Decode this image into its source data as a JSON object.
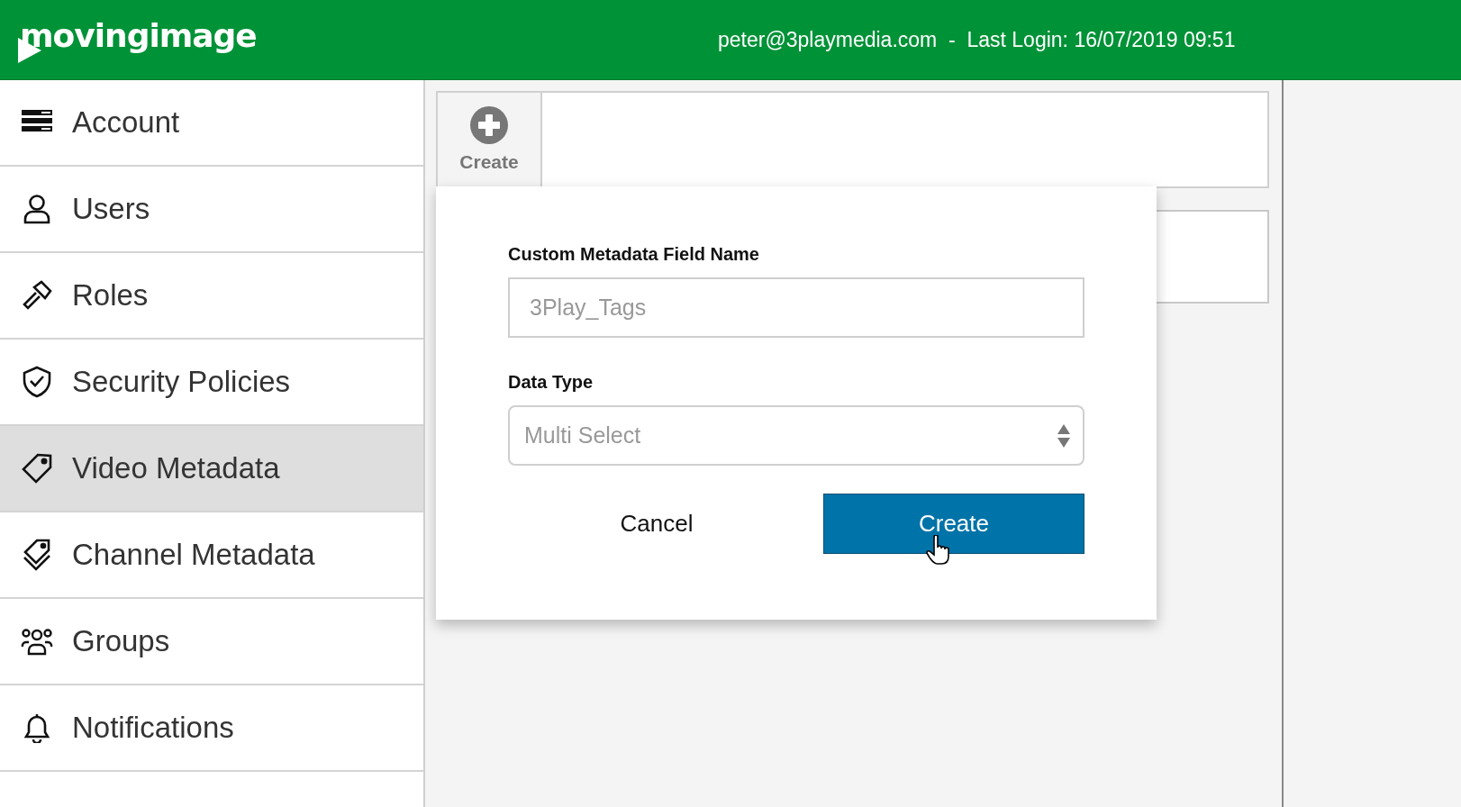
{
  "header": {
    "logo": "movingimage",
    "user_info": "peter@3playmedia.com  -  Last Login: 16/07/2019 09:51"
  },
  "sidebar": {
    "items": [
      {
        "label": "Account",
        "selected": false
      },
      {
        "label": "Users",
        "selected": false
      },
      {
        "label": "Roles",
        "selected": false
      },
      {
        "label": "Security Policies",
        "selected": false
      },
      {
        "label": "Video Metadata",
        "selected": true
      },
      {
        "label": "Channel Metadata",
        "selected": false
      },
      {
        "label": "Groups",
        "selected": false
      },
      {
        "label": "Notifications",
        "selected": false
      }
    ]
  },
  "toolbar": {
    "create_button": "Create"
  },
  "dialog": {
    "name_label": "Custom Metadata Field Name",
    "name_value": "3Play_Tags",
    "type_label": "Data Type",
    "type_value": "Multi Select",
    "cancel_button": "Cancel",
    "create_button": "Create"
  }
}
